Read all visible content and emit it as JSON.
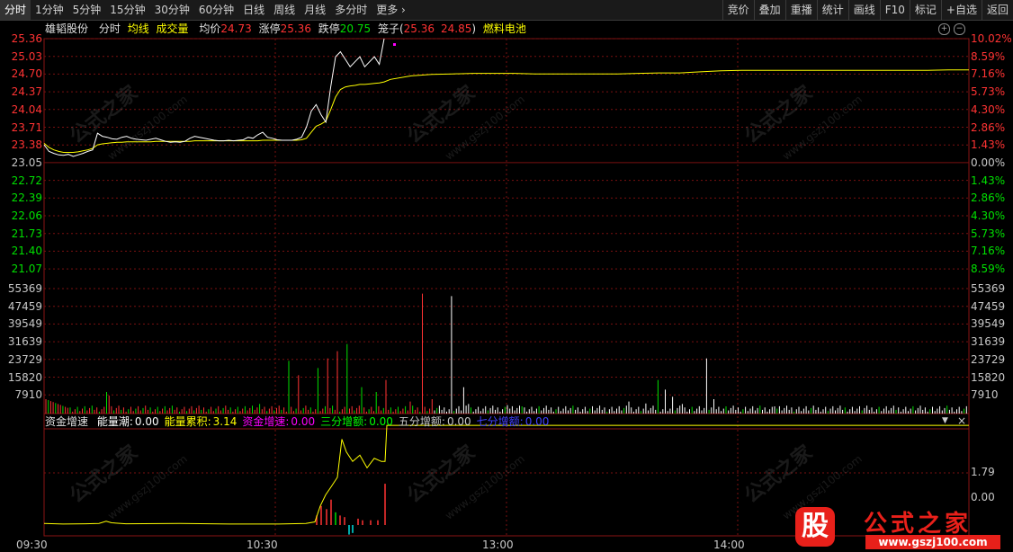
{
  "toolbar": {
    "periods": [
      "分时",
      "1分钟",
      "5分钟",
      "15分钟",
      "30分钟",
      "60分钟",
      "日线",
      "周线",
      "月线",
      "多分时",
      "更多 ›"
    ],
    "actions": [
      "竞价",
      "叠加",
      "重播",
      "统计",
      "画线",
      "F10",
      "标记",
      "+自选",
      "返回"
    ]
  },
  "info": {
    "stock_name": "雄韬股份",
    "label_fenshi": "分时",
    "label_junxian": "均线",
    "label_volume": "成交量",
    "avg_label": "均价",
    "avg_value": "24.73",
    "limit_up_label": "涨停",
    "limit_up_value": "25.36",
    "limit_down_label": "跌停",
    "limit_down_value": "20.75",
    "basket_label": "笼子(",
    "basket_high": "25.36",
    "basket_low": "24.85",
    "basket_close": ")",
    "concept": "燃料电池"
  },
  "price_axis": {
    "left": [
      "25.36",
      "25.03",
      "24.70",
      "24.37",
      "24.04",
      "23.71",
      "23.38",
      "23.05",
      "22.72",
      "22.39",
      "22.06",
      "21.73",
      "21.40",
      "21.07"
    ],
    "right": [
      "10.02%",
      "8.59%",
      "7.16%",
      "5.73%",
      "4.30%",
      "2.86%",
      "1.43%",
      "0.00%",
      "1.43%",
      "2.86%",
      "4.30%",
      "5.73%",
      "7.16%",
      "8.59%"
    ]
  },
  "volume_axis": [
    "55369",
    "47459",
    "39549",
    "31639",
    "23729",
    "15820",
    "7910"
  ],
  "indicator": {
    "name": "资金增速",
    "items": [
      {
        "label": "能量潮:",
        "value": "0.00",
        "color": "#ffffff"
      },
      {
        "label": "能量累积:",
        "value": "3.14",
        "color": "#ffff00"
      },
      {
        "label": "资金增速:",
        "value": "0.00",
        "color": "#ff00ff"
      },
      {
        "label": "三分增额:",
        "value": "0.00",
        "color": "#00ff00"
      },
      {
        "label": "五分增额:",
        "value": "0.00",
        "color": "#c8c8c8"
      },
      {
        "label": "七分增额:",
        "value": "0.00",
        "color": "#4040ff"
      }
    ],
    "axis": [
      "1.79",
      "0.00"
    ]
  },
  "time_axis": [
    "09:30",
    "10:30",
    "13:00",
    "14:00"
  ],
  "colors": {
    "up": "#ff3333",
    "down": "#00e000",
    "avg": "#ffff00",
    "price": "#ffffff",
    "grid": "#7a1010"
  },
  "watermark": {
    "text": "公式之家",
    "url": "www.gszj100.com"
  },
  "logo": {
    "glyph": "股",
    "title": "公式之家",
    "url": "www.gszj100.com"
  },
  "chart_data": {
    "type": "line",
    "price_range": [
      20.75,
      25.36
    ],
    "base_price": 23.05,
    "series": [
      {
        "name": "分时",
        "color": "#ffffff",
        "values": [
          23.25,
          23.12,
          23.08,
          23.05,
          23.04,
          23.06,
          23.02,
          23.05,
          23.08,
          23.12,
          23.15,
          23.48,
          23.42,
          23.4,
          23.37,
          23.36,
          23.4,
          23.42,
          23.38,
          23.36,
          23.35,
          23.34,
          23.36,
          23.38,
          23.35,
          23.32,
          23.3,
          23.31,
          23.3,
          23.32,
          23.38,
          23.42,
          23.4,
          23.38,
          23.36,
          23.34,
          23.33,
          23.33,
          23.34,
          23.33,
          23.34,
          23.35,
          23.4,
          23.38,
          23.45,
          23.5,
          23.4,
          23.38,
          23.35,
          23.34,
          23.34,
          23.34,
          23.36,
          23.4,
          23.6,
          23.92,
          24.05,
          23.85,
          23.7,
          24.4,
          25.0,
          25.1,
          24.95,
          24.8,
          24.9,
          25.0,
          24.8,
          24.9,
          25.0,
          24.85,
          25.36
        ]
      },
      {
        "name": "均线",
        "color": "#ffff00",
        "values": [
          23.28,
          23.2,
          23.15,
          23.12,
          23.1,
          23.1,
          23.1,
          23.11,
          23.13,
          23.15,
          23.18,
          23.25,
          23.27,
          23.28,
          23.29,
          23.3,
          23.3,
          23.31,
          23.31,
          23.31,
          23.31,
          23.31,
          23.31,
          23.32,
          23.32,
          23.32,
          23.32,
          23.32,
          23.32,
          23.32,
          23.32,
          23.33,
          23.33,
          23.33,
          23.33,
          23.33,
          23.33,
          23.33,
          23.33,
          23.33,
          23.33,
          23.33,
          23.33,
          23.33,
          23.33,
          23.34,
          23.34,
          23.34,
          23.34,
          23.34,
          23.34,
          23.34,
          23.34,
          23.35,
          23.38,
          23.5,
          23.62,
          23.66,
          23.72,
          23.95,
          24.2,
          24.35,
          24.4,
          24.42,
          24.43,
          24.45,
          24.45,
          24.46,
          24.47,
          24.48,
          24.5,
          24.55,
          24.62,
          24.65,
          24.66,
          24.67,
          24.67,
          24.67,
          24.66,
          24.66,
          24.66,
          24.66,
          24.66,
          24.67,
          24.68,
          24.68,
          24.7,
          24.72,
          24.73,
          24.73,
          24.73,
          24.73,
          24.73,
          24.73,
          24.73,
          24.73,
          24.73,
          24.73,
          24.74,
          24.74
        ]
      }
    ]
  }
}
